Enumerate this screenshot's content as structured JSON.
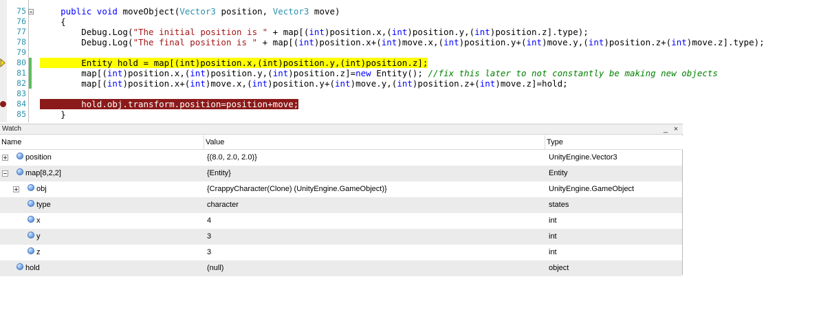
{
  "editor": {
    "lines": [
      {
        "num": "75",
        "indent": "    ",
        "tokens": [
          [
            "kw",
            "public "
          ],
          [
            "kw",
            "void "
          ],
          [
            "plain",
            "moveObject("
          ],
          [
            "type",
            "Vector3"
          ],
          [
            "plain",
            " position, "
          ],
          [
            "type",
            "Vector3"
          ],
          [
            "plain",
            " move)"
          ]
        ]
      },
      {
        "num": "76",
        "indent": "    ",
        "tokens": [
          [
            "plain",
            "{"
          ]
        ]
      },
      {
        "num": "77",
        "indent": "        ",
        "tokens": [
          [
            "plain",
            "Debug.Log("
          ],
          [
            "str",
            "\"The initial position is \""
          ],
          [
            "plain",
            " + map[("
          ],
          [
            "kw",
            "int"
          ],
          [
            "plain",
            ")position.x,("
          ],
          [
            "kw",
            "int"
          ],
          [
            "plain",
            ")position.y,("
          ],
          [
            "kw",
            "int"
          ],
          [
            "plain",
            ")position.z].type);"
          ]
        ]
      },
      {
        "num": "78",
        "indent": "        ",
        "tokens": [
          [
            "plain",
            "Debug.Log("
          ],
          [
            "str",
            "\"The final position is \""
          ],
          [
            "plain",
            " + map[("
          ],
          [
            "kw",
            "int"
          ],
          [
            "plain",
            ")position.x+("
          ],
          [
            "kw",
            "int"
          ],
          [
            "plain",
            ")move.x,("
          ],
          [
            "kw",
            "int"
          ],
          [
            "plain",
            ")position.y+("
          ],
          [
            "kw",
            "int"
          ],
          [
            "plain",
            ")move.y,("
          ],
          [
            "kw",
            "int"
          ],
          [
            "plain",
            ")position.z+("
          ],
          [
            "kw",
            "int"
          ],
          [
            "plain",
            ")move.z].type);"
          ]
        ]
      },
      {
        "num": "79",
        "indent": "",
        "tokens": []
      },
      {
        "num": "80",
        "indent": "        ",
        "tokens": [
          [
            "plain",
            "Entity hold = map[(int)position.x,(int)position.y,(int)position.z];"
          ]
        ]
      },
      {
        "num": "81",
        "indent": "        ",
        "tokens": [
          [
            "plain",
            "map[("
          ],
          [
            "kw",
            "int"
          ],
          [
            "plain",
            ")position.x,("
          ],
          [
            "kw",
            "int"
          ],
          [
            "plain",
            ")position.y,("
          ],
          [
            "kw",
            "int"
          ],
          [
            "plain",
            ")position.z]="
          ],
          [
            "kw",
            "new"
          ],
          [
            "plain",
            " Entity(); "
          ],
          [
            "cmt",
            "//fix this later to not constantly be making new objects"
          ]
        ]
      },
      {
        "num": "82",
        "indent": "        ",
        "tokens": [
          [
            "plain",
            "map[("
          ],
          [
            "kw",
            "int"
          ],
          [
            "plain",
            ")position.x+("
          ],
          [
            "kw",
            "int"
          ],
          [
            "plain",
            ")move.x,("
          ],
          [
            "kw",
            "int"
          ],
          [
            "plain",
            ")position.y+("
          ],
          [
            "kw",
            "int"
          ],
          [
            "plain",
            ")move.y,("
          ],
          [
            "kw",
            "int"
          ],
          [
            "plain",
            ")position.z+("
          ],
          [
            "kw",
            "int"
          ],
          [
            "plain",
            ")move.z]=hold;"
          ]
        ]
      },
      {
        "num": "83",
        "indent": "",
        "tokens": []
      },
      {
        "num": "84",
        "indent": "        ",
        "tokens": [
          [
            "red",
            "hold.obj.transform.position=position+move;"
          ]
        ]
      },
      {
        "num": "85",
        "indent": "    ",
        "tokens": [
          [
            "plain",
            "}"
          ]
        ]
      }
    ]
  },
  "watch": {
    "title": "Watch",
    "minimize_label": "_",
    "close_label": "×",
    "columns": {
      "name": "Name",
      "value": "Value",
      "type": "Type"
    },
    "rows": [
      {
        "name": "position",
        "value": "{(8.0, 2.0, 2.0)}",
        "type": "UnityEngine.Vector3",
        "expander": "plus",
        "level": 0,
        "alt": false
      },
      {
        "name": "map[8,2,2]",
        "value": "{Entity}",
        "type": "Entity",
        "expander": "minus",
        "level": 0,
        "alt": true
      },
      {
        "name": "obj",
        "value": "{CrappyCharacter(Clone) (UnityEngine.GameObject)}",
        "type": "UnityEngine.GameObject",
        "expander": "plus",
        "level": 1,
        "alt": false
      },
      {
        "name": "type",
        "value": "character",
        "type": "states",
        "expander": "none",
        "level": 1,
        "alt": true
      },
      {
        "name": "x",
        "value": "4",
        "type": "int",
        "expander": "none",
        "level": 1,
        "alt": false
      },
      {
        "name": "y",
        "value": "3",
        "type": "int",
        "expander": "none",
        "level": 1,
        "alt": true
      },
      {
        "name": "z",
        "value": "3",
        "type": "int",
        "expander": "none",
        "level": 1,
        "alt": false
      },
      {
        "name": "hold",
        "value": "(null)",
        "type": "object",
        "expander": "none",
        "level": 0,
        "alt": true
      }
    ]
  },
  "colors": {
    "current_statement_highlight": "#ffff00",
    "breakpoint_highlight": "#8b1a1a",
    "line_number": "#2b91af",
    "keyword": "#0000ff",
    "string": "#a31515",
    "comment": "#008000"
  }
}
